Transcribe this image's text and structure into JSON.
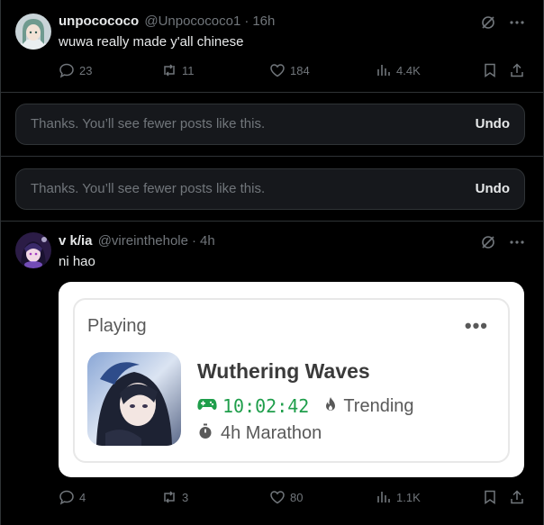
{
  "posts": [
    {
      "display_name": "unpocococo",
      "handle": "@Unpocococo1",
      "time": "16h",
      "text": "wuwa really made y'all chinese",
      "stats": {
        "replies": "23",
        "reposts": "11",
        "likes": "184",
        "views": "4.4K"
      }
    },
    {
      "display_name": "v k/ia",
      "handle": "@vireinthehole",
      "time": "4h",
      "text": "ni hao",
      "stats": {
        "replies": "4",
        "reposts": "3",
        "likes": "80",
        "views": "1.1K"
      },
      "media": {
        "playing_label": "Playing",
        "menu": "•••",
        "game_title": "Wuthering Waves",
        "timer": "10:02:42",
        "trending": "Trending",
        "marathon": "4h Marathon"
      }
    }
  ],
  "notices": [
    {
      "message": "Thanks. You’ll see fewer posts like this.",
      "action": "Undo"
    },
    {
      "message": "Thanks. You’ll see fewer posts like this.",
      "action": "Undo"
    }
  ],
  "separator": "·",
  "colors": {
    "background": "#000000",
    "text": "#e7e9ea",
    "secondary": "#71767b",
    "border": "#2f3336",
    "timer_green": "#1f9e4b"
  },
  "icons": [
    "grok-icon",
    "more-icon",
    "reply-icon",
    "repost-icon",
    "like-icon",
    "views-icon",
    "bookmark-icon",
    "share-icon",
    "gamepad-icon",
    "fire-icon",
    "stopwatch-icon"
  ]
}
